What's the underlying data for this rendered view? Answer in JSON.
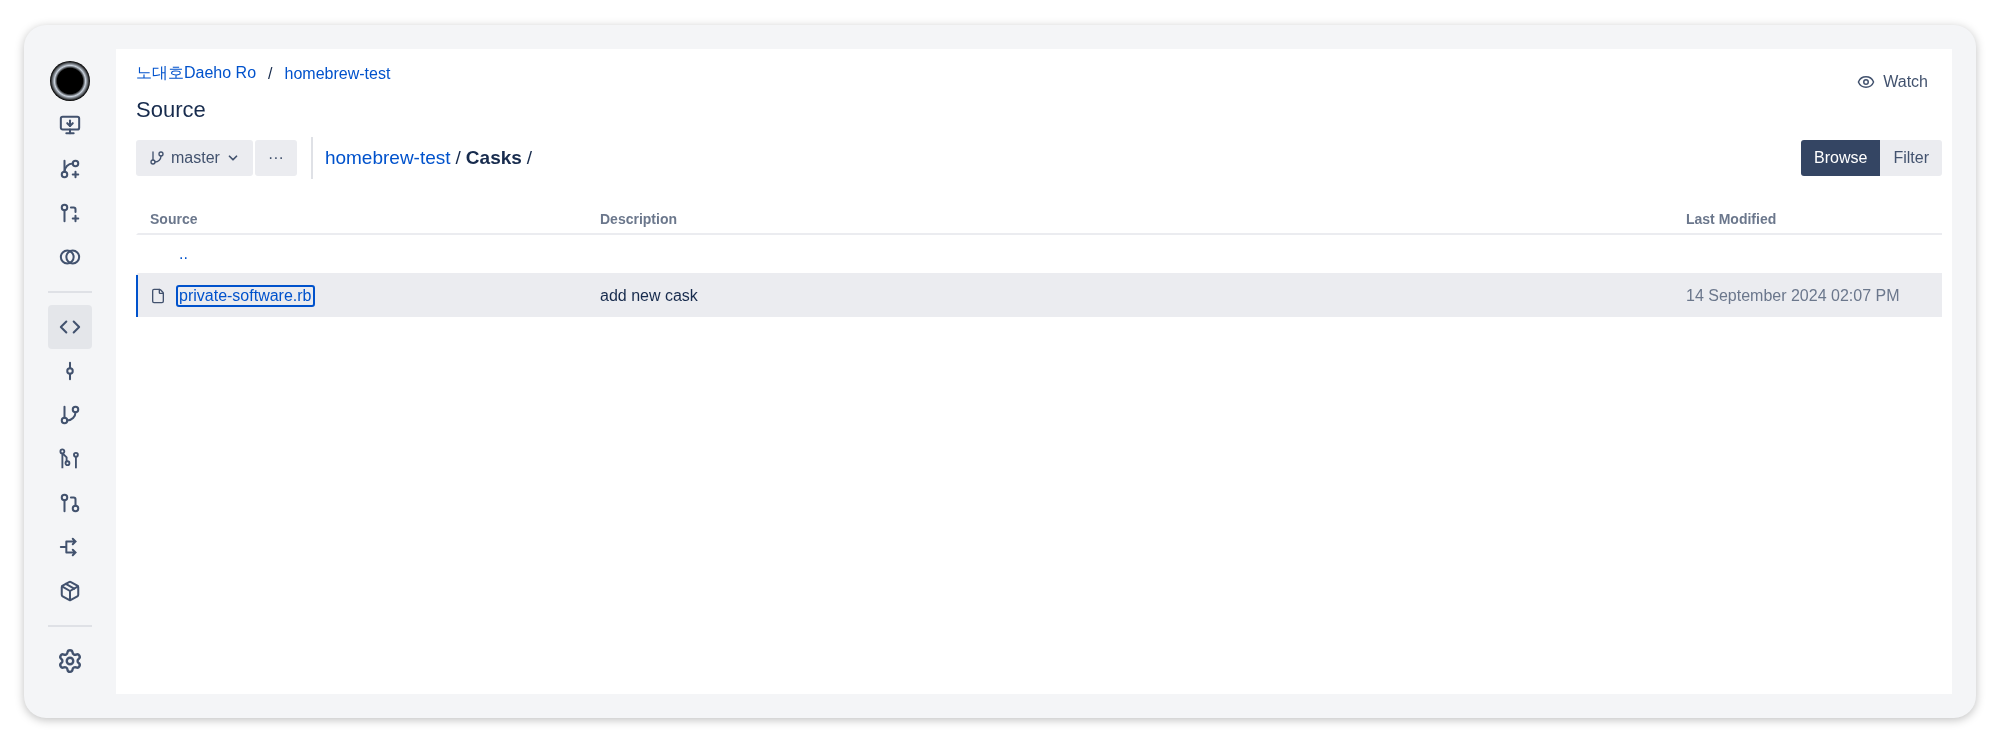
{
  "sidebar": {
    "groups": [
      {
        "items": [
          {
            "kind": "avatar",
            "selected": false
          },
          {
            "kind": "clone",
            "selected": false
          },
          {
            "kind": "branch-create",
            "selected": false
          },
          {
            "kind": "pr-create",
            "selected": false
          },
          {
            "kind": "compare",
            "selected": false
          }
        ]
      },
      {
        "items": [
          {
            "kind": "source",
            "selected": true
          },
          {
            "kind": "commits",
            "selected": false
          },
          {
            "kind": "branches",
            "selected": false
          },
          {
            "kind": "graph",
            "selected": false
          },
          {
            "kind": "pull-requests",
            "selected": false
          },
          {
            "kind": "forks",
            "selected": false
          },
          {
            "kind": "artifacts",
            "selected": false
          }
        ]
      },
      {
        "items": [
          {
            "kind": "settings",
            "selected": false
          }
        ]
      }
    ]
  },
  "breadcrumb": {
    "project": "노대호Daeho Ro",
    "separator": "/",
    "repository": "homebrew-test"
  },
  "watch": {
    "label": "Watch"
  },
  "title": "Source",
  "toolbar": {
    "branch": "master",
    "more": "···",
    "path": {
      "repository": "homebrew-test",
      "separator": "/",
      "folder": "Casks",
      "trailing": "/"
    },
    "views": [
      {
        "label": "Browse",
        "selected": true
      },
      {
        "label": "Filter",
        "selected": false
      }
    ]
  },
  "table": {
    "columns": [
      "Source",
      "Description",
      "Last Modified"
    ],
    "rows": [
      {
        "kind": "parent",
        "name": "..",
        "selected": false
      },
      {
        "kind": "file",
        "name": "private-software.rb",
        "description": "add new cask",
        "modified": "14 September 2024 02:07 PM",
        "selected": true
      }
    ]
  }
}
